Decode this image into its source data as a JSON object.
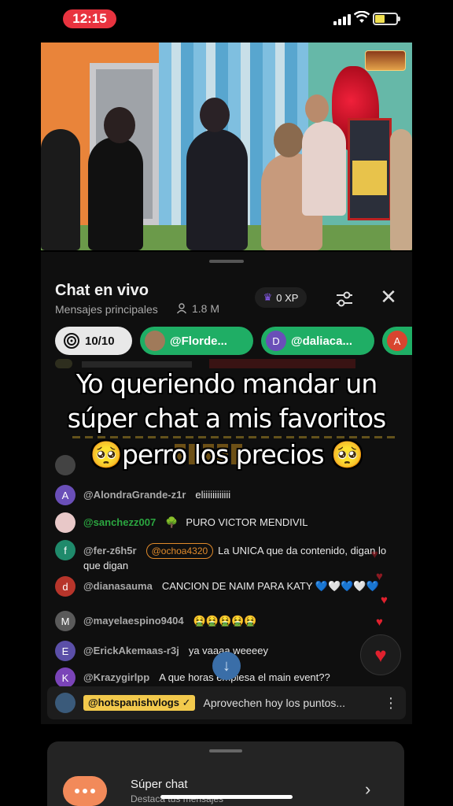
{
  "status_bar": {
    "time": "12:15"
  },
  "chat": {
    "title": "Chat en vivo",
    "mode": "Mensajes principales",
    "viewers": "1.8 M",
    "xp": "0 XP",
    "close_label": "✕",
    "goal": "10/10",
    "donors": [
      {
        "label": "@Florde...",
        "initial": ""
      },
      {
        "label": "@daliaca...",
        "initial": "D"
      },
      {
        "label": "",
        "initial": "A"
      }
    ],
    "messages": [
      {
        "initial": "A",
        "author": "@AlondraGrande-z1r",
        "text": "eliiiiiiiiiiii",
        "color": "#6a4fb8"
      },
      {
        "initial": "",
        "author": "@sanchezz007",
        "text": "PURO VICTOR MENDIVIL",
        "color": "#c7787a",
        "member": true
      },
      {
        "initial": "f",
        "author": "@fer-z6h5r",
        "mention": "@ochoa4320",
        "text": "La UNICA que da contenido, digan lo que digan",
        "color": "#1f8a6b"
      },
      {
        "initial": "d",
        "author": "@dianasauma",
        "text": "CANCION DE NAIM PARA KATY 💙🤍💙🤍💙",
        "color": "#b7352b"
      },
      {
        "initial": "M",
        "author": "@mayelaespino9404",
        "text": "🤮🤮🤮🤮🤮",
        "color": "#5a5a5a"
      },
      {
        "initial": "E",
        "author": "@ErickAkemaas-r3j",
        "text": "ya vaaaa weeeey",
        "color": "#5b4fa8"
      },
      {
        "initial": "K",
        "author": "@Krazygirlpp",
        "text": "A que horas empiesa el main event??",
        "color": "#7a44b8"
      }
    ],
    "pinned": {
      "author": "@hotspanishvlogs ✓",
      "text": "Aprovechen hoy los puntos..."
    }
  },
  "overlay": {
    "line1": "Yo queriendo mandar un",
    "line2": "súper chat a mis favoritos",
    "line3": "🥺perro los precios 🥺"
  },
  "sheet": {
    "title": "Súper chat",
    "subtitle": "Destaca tus mensajes"
  },
  "colors": {
    "accent_green": "#1fae65",
    "heart_red": "#e0212e",
    "pin_yellow": "#f2c94c",
    "live_red": "#e8333f"
  }
}
